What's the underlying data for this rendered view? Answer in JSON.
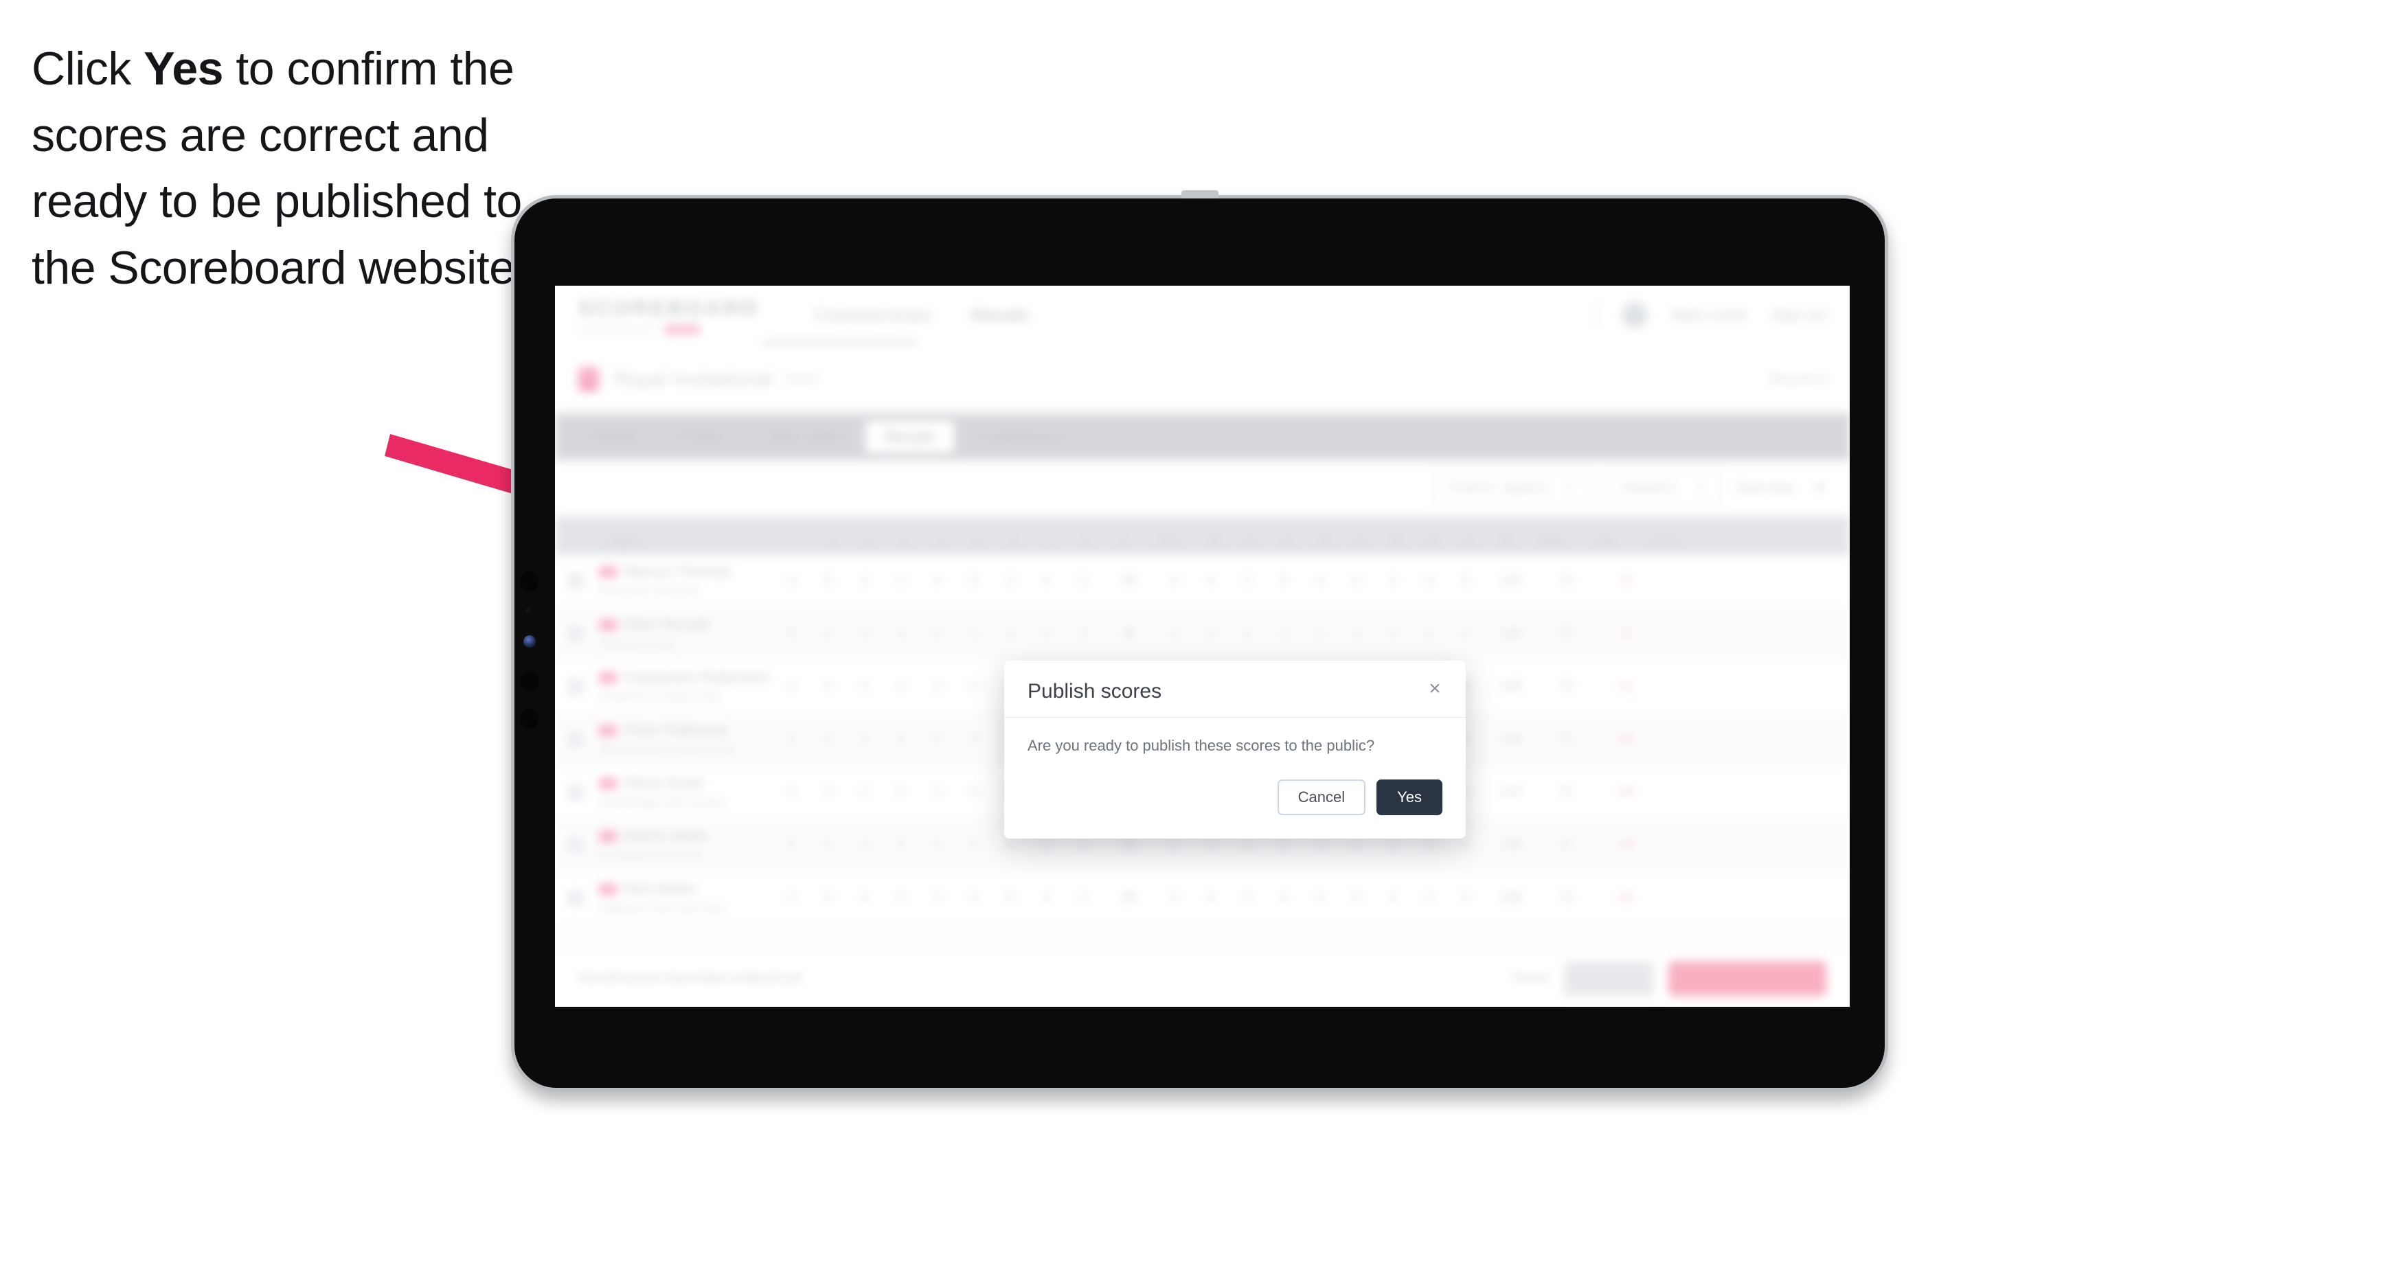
{
  "caption": {
    "before": "Click ",
    "bold": "Yes",
    "after": " to confirm the scores are correct and ready to be published to the Scoreboard website."
  },
  "annotation": {
    "arrow_color": "#ea2a62",
    "arrow_name": "pointer-arrow-to-yes-button"
  },
  "device": {
    "type": "tablet",
    "bezel_color": "#0b0b0b",
    "frame_color": "#b9bcc0"
  },
  "app": {
    "navbar": {
      "logo_word": "SCOREBOARD",
      "logo_sub": "POWERED BY",
      "links": [
        {
          "label": "Championships"
        },
        {
          "label": "Results"
        }
      ],
      "user_name": "Mark Lewis",
      "sign_out": "Sign out"
    },
    "event_header": {
      "title": "Royal Invitational",
      "subtitle": "2024",
      "meta": "Round 3"
    },
    "tabs": [
      {
        "label": "Details"
      },
      {
        "label": "Entries"
      },
      {
        "label": "Start sheet"
      },
      {
        "label": "Results"
      },
      {
        "label": "Leaderboard"
      }
    ],
    "active_tab": "Results",
    "toolbar": {
      "filter_holes": "Front 9 - Back 9",
      "filter_round": "Round 3",
      "filter_order": "Start time"
    },
    "table": {
      "headers": {
        "player": "Player",
        "holes": [
          "1",
          "2",
          "3",
          "4",
          "5",
          "6",
          "7",
          "8",
          "9",
          "10",
          "11",
          "12",
          "13",
          "14",
          "15",
          "16",
          "17",
          "18"
        ],
        "out": "Out",
        "total": "Total",
        "par": "Par",
        "score": "Score"
      },
      "rows": [
        {
          "name": "Marcus Thomas",
          "team": "Riverside Golf Club",
          "scores": [
            "4",
            "5",
            "3",
            "4",
            "4",
            "5",
            "3",
            "4",
            "5",
            "4",
            "4",
            "3",
            "5",
            "4",
            "4",
            "3",
            "4",
            "5"
          ],
          "out": "36",
          "par": "72",
          "score": "-2",
          "total": "142"
        },
        {
          "name": "Ellen Ronald",
          "team": "Oakmont Links",
          "scores": [
            "5",
            "4",
            "4",
            "3",
            "5",
            "4",
            "4",
            "5",
            "3",
            "4",
            "5",
            "4",
            "3",
            "4",
            "5",
            "4",
            "4",
            "4"
          ],
          "out": "36",
          "par": "72",
          "score": "-1",
          "total": "144"
        },
        {
          "name": "Cassandra Robertson",
          "team": "Pinehurst Country Club",
          "scores": [
            "4",
            "4",
            "5",
            "4",
            "3",
            "5",
            "4",
            "4",
            "4",
            "5",
            "3",
            "4",
            "4",
            "5",
            "4",
            "4",
            "3",
            "5"
          ],
          "out": "37",
          "par": "72",
          "score": "+1",
          "total": "145"
        },
        {
          "name": "Chris Patterson",
          "team": "Westchester Country Club",
          "scores": [
            "3",
            "5",
            "4",
            "4",
            "5",
            "4",
            "3",
            "5",
            "4",
            "4",
            "4",
            "5",
            "3",
            "4",
            "4",
            "5",
            "4",
            "3"
          ],
          "out": "37",
          "par": "71",
          "score": "+2",
          "total": "146"
        },
        {
          "name": "Olivia Grant",
          "team": "Sandbridge Golf Society",
          "scores": [
            "4",
            "4",
            "4",
            "5",
            "4",
            "3",
            "5",
            "4",
            "4",
            "4",
            "5",
            "4",
            "4",
            "3",
            "5",
            "4",
            "4",
            "4"
          ],
          "out": "38",
          "par": "71",
          "score": "+3",
          "total": "147"
        },
        {
          "name": "Naomi Wells",
          "team": "Brookfield Golf Club",
          "scores": [
            "5",
            "4",
            "3",
            "4",
            "4",
            "5",
            "4",
            "4",
            "5",
            "3",
            "4",
            "4",
            "5",
            "4",
            "4",
            "4",
            "3",
            "4"
          ],
          "out": "38",
          "par": "72",
          "score": "+4",
          "total": "148"
        },
        {
          "name": "Nick Baker",
          "team": "Highland Park Golf Club",
          "scores": [
            "4",
            "5",
            "4",
            "4",
            "3",
            "4",
            "5",
            "4",
            "4",
            "5",
            "4",
            "3",
            "4",
            "4",
            "5",
            "4",
            "4",
            "5"
          ],
          "out": "39",
          "par": "72",
          "score": "+5",
          "total": "150"
        }
      ]
    },
    "bottom_bar": {
      "note": "Not all scores have been entered yet",
      "link": "Reset",
      "secondary_button": "Save",
      "primary_button": "Publish scores to public"
    }
  },
  "modal": {
    "name": "publish-scores-dialog",
    "title": "Publish scores",
    "close_glyph": "×",
    "message": "Are you ready to publish these scores to the public?",
    "cancel_label": "Cancel",
    "confirm_label": "Yes",
    "confirm_bg": "#2b3443",
    "cancel_border": "#ccd7ea"
  }
}
